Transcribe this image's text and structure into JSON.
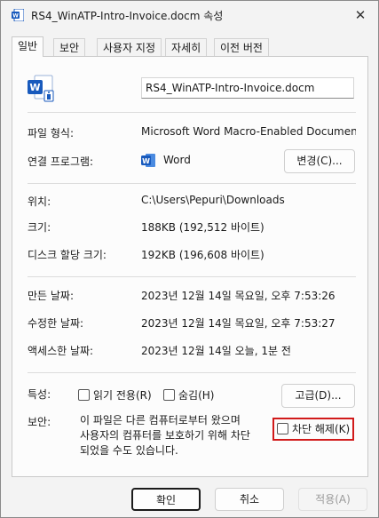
{
  "window": {
    "title": "RS4_WinATP-Intro-Invoice.docm 속성",
    "close_glyph": "✕"
  },
  "tabs": [
    {
      "label": "일반",
      "active": true
    },
    {
      "label": "보안",
      "active": false
    },
    {
      "label": "사용자 지정",
      "active": false
    },
    {
      "label": "자세히",
      "active": false
    },
    {
      "label": "이전 버전",
      "active": false
    }
  ],
  "general": {
    "file_icon": "word-macro-file-icon",
    "filename": "RS4_WinATP-Intro-Invoice.docm",
    "file_type_label": "파일 형식:",
    "file_type_value": "Microsoft Word Macro-Enabled Document(.d",
    "open_with_label": "연결 프로그램:",
    "open_with_app_icon": "word-icon",
    "open_with_value": "Word",
    "change_button": "변경(C)...",
    "location_label": "위치:",
    "location_value": "C:\\Users\\Pepuri\\Downloads",
    "size_label": "크기:",
    "size_value": "188KB (192,512 바이트)",
    "size_on_disk_label": "디스크 할당 크기:",
    "size_on_disk_value": "192KB (196,608 바이트)",
    "created_label": "만든 날짜:",
    "created_value": "2023년 12월 14일 목요일, 오후 7:53:26",
    "modified_label": "수정한 날짜:",
    "modified_value": "2023년 12월 14일 목요일, 오후 7:53:27",
    "accessed_label": "액세스한 날짜:",
    "accessed_value": "2023년 12월 14일 오늘, 1분 전",
    "attributes_label": "특성:",
    "readonly_label": "읽기 전용(R)",
    "readonly_checked": false,
    "hidden_label": "숨김(H)",
    "hidden_checked": false,
    "advanced_button": "고급(D)...",
    "security_label": "보안:",
    "security_line1": "이 파일은 다른 컴퓨터로부터 왔으며",
    "security_line2": "사용자의 컴퓨터를 보호하기 위해 차단",
    "security_line3": "되었을 수도 있습니다.",
    "unblock_label": "차단 해제(K)",
    "unblock_checked": false
  },
  "footer": {
    "ok": "확인",
    "cancel": "취소",
    "apply": "적용(A)"
  },
  "colors": {
    "word_blue": "#185abd",
    "highlight_red": "#d11a1a"
  }
}
